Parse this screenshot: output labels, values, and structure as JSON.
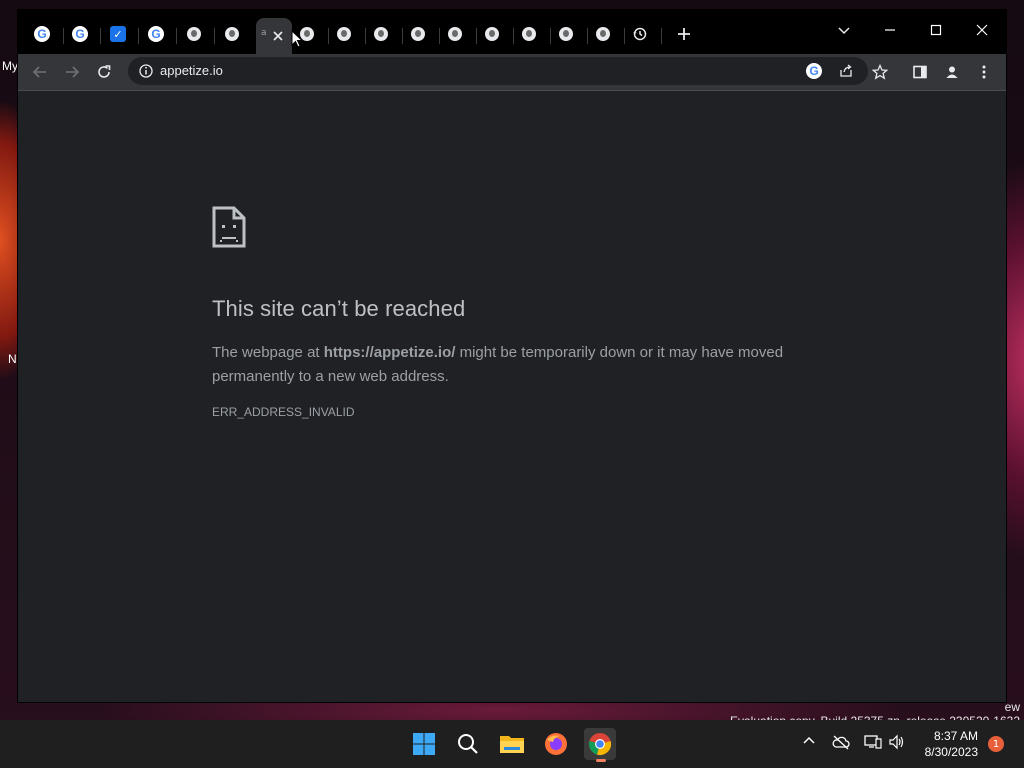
{
  "desktop": {
    "icon_label_1": "My",
    "icon_label_2": "N",
    "watermark_line1": "ew",
    "watermark_line2": "Evaluation copy. Build 25375.zn_release.230520-1632"
  },
  "browser": {
    "tabs": [
      {
        "icon": "google-icon"
      },
      {
        "icon": "google-icon"
      },
      {
        "icon": "todo-icon"
      },
      {
        "icon": "google-icon"
      },
      {
        "icon": "globe-icon"
      },
      {
        "icon": "globe-icon"
      },
      {
        "icon": "active-tab",
        "label": "a"
      },
      {
        "icon": "globe-icon"
      },
      {
        "icon": "globe-icon"
      },
      {
        "icon": "globe-icon"
      },
      {
        "icon": "globe-icon"
      },
      {
        "icon": "globe-icon"
      },
      {
        "icon": "globe-icon"
      },
      {
        "icon": "globe-icon"
      },
      {
        "icon": "globe-icon"
      },
      {
        "icon": "globe-icon"
      },
      {
        "icon": "history-icon"
      }
    ],
    "address": {
      "url": "appetize.io"
    }
  },
  "error_page": {
    "title": "This site can’t be reached",
    "body_prefix": "The webpage at ",
    "body_url": "https://appetize.io/",
    "body_suffix": " might be temporarily down or it may have moved permanently to a new web address.",
    "error_code": "ERR_ADDRESS_INVALID"
  },
  "taskbar": {
    "time": "8:37 AM",
    "date": "8/30/2023",
    "notification_count": "1"
  },
  "colors": {
    "page_bg": "#202124",
    "title_text": "#bdc1c6",
    "body_text": "#9aa0a6",
    "toolbar": "#35363a",
    "accent_blue": "#1a73e8"
  }
}
